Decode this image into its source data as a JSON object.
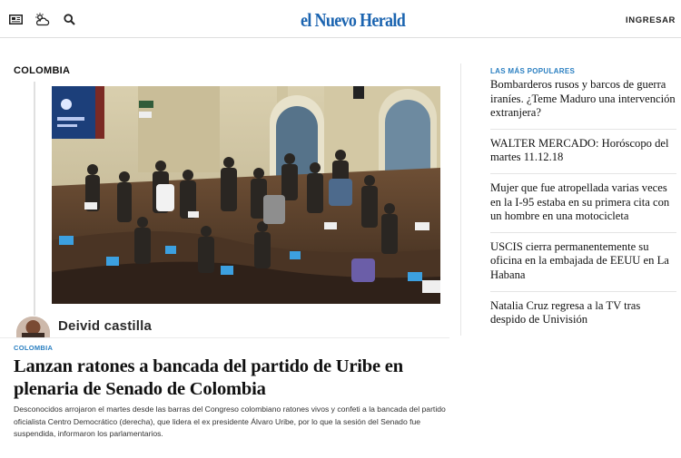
{
  "header": {
    "logo_text": "el Nuevo Herald",
    "login_label": "INGRESAR",
    "icons": [
      "newspaper-icon",
      "weather-icon",
      "search-icon"
    ]
  },
  "section": {
    "label": "COLOMBIA"
  },
  "article": {
    "author_name": "Deivid castilla",
    "kicker": "COLOMBIA",
    "headline": "Lanzan ratones a bancada del partido de Uribe en plenaria de Senado de Colombia",
    "summary": "Desconocidos arrojaron el martes desde las barras del Congreso colombiano ratones vivos y confeti a la bancada del partido oficialista Centro Democrático (derecha), que lidera el ex presidente Álvaro Uribe, por lo que la sesión del Senado fue suspendida, informaron los parlamentarios."
  },
  "sidebar": {
    "title": "LAS MÁS POPULARES",
    "items": [
      {
        "text": "Bombarderos rusos y barcos de guerra iraníes. ¿Teme Maduro una intervención extranjera?"
      },
      {
        "text": "WALTER MERCADO: Horóscopo del martes 11.12.18"
      },
      {
        "text": "Mujer que fue atropellada varias veces en la I-95 estaba en su primera cita con un hombre en una motocicleta"
      },
      {
        "text": "USCIS cierra permanentemente su oficina en la embajada de EEUU en La Habana"
      },
      {
        "text": "Natalia Cruz regresa a la TV tras despido de Univisión"
      }
    ]
  },
  "colors": {
    "brand_blue": "#1b64b0",
    "accent_blue": "#2a7fc1"
  }
}
